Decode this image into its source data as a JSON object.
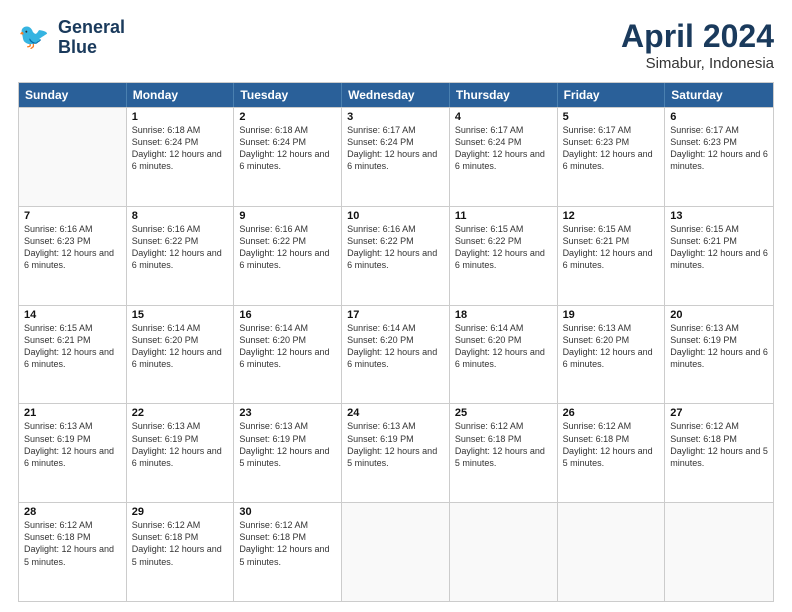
{
  "logo": {
    "line1": "General",
    "line2": "Blue"
  },
  "title": "April 2024",
  "subtitle": "Simabur, Indonesia",
  "days": [
    "Sunday",
    "Monday",
    "Tuesday",
    "Wednesday",
    "Thursday",
    "Friday",
    "Saturday"
  ],
  "weeks": [
    [
      {
        "day": "",
        "empty": true
      },
      {
        "day": "1",
        "sunrise": "6:18 AM",
        "sunset": "6:24 PM",
        "daylight": "12 hours and 6 minutes."
      },
      {
        "day": "2",
        "sunrise": "6:18 AM",
        "sunset": "6:24 PM",
        "daylight": "12 hours and 6 minutes."
      },
      {
        "day": "3",
        "sunrise": "6:17 AM",
        "sunset": "6:24 PM",
        "daylight": "12 hours and 6 minutes."
      },
      {
        "day": "4",
        "sunrise": "6:17 AM",
        "sunset": "6:24 PM",
        "daylight": "12 hours and 6 minutes."
      },
      {
        "day": "5",
        "sunrise": "6:17 AM",
        "sunset": "6:23 PM",
        "daylight": "12 hours and 6 minutes."
      },
      {
        "day": "6",
        "sunrise": "6:17 AM",
        "sunset": "6:23 PM",
        "daylight": "12 hours and 6 minutes."
      }
    ],
    [
      {
        "day": "7",
        "sunrise": "6:16 AM",
        "sunset": "6:23 PM",
        "daylight": "12 hours and 6 minutes."
      },
      {
        "day": "8",
        "sunrise": "6:16 AM",
        "sunset": "6:22 PM",
        "daylight": "12 hours and 6 minutes."
      },
      {
        "day": "9",
        "sunrise": "6:16 AM",
        "sunset": "6:22 PM",
        "daylight": "12 hours and 6 minutes."
      },
      {
        "day": "10",
        "sunrise": "6:16 AM",
        "sunset": "6:22 PM",
        "daylight": "12 hours and 6 minutes."
      },
      {
        "day": "11",
        "sunrise": "6:15 AM",
        "sunset": "6:22 PM",
        "daylight": "12 hours and 6 minutes."
      },
      {
        "day": "12",
        "sunrise": "6:15 AM",
        "sunset": "6:21 PM",
        "daylight": "12 hours and 6 minutes."
      },
      {
        "day": "13",
        "sunrise": "6:15 AM",
        "sunset": "6:21 PM",
        "daylight": "12 hours and 6 minutes."
      }
    ],
    [
      {
        "day": "14",
        "sunrise": "6:15 AM",
        "sunset": "6:21 PM",
        "daylight": "12 hours and 6 minutes."
      },
      {
        "day": "15",
        "sunrise": "6:14 AM",
        "sunset": "6:20 PM",
        "daylight": "12 hours and 6 minutes."
      },
      {
        "day": "16",
        "sunrise": "6:14 AM",
        "sunset": "6:20 PM",
        "daylight": "12 hours and 6 minutes."
      },
      {
        "day": "17",
        "sunrise": "6:14 AM",
        "sunset": "6:20 PM",
        "daylight": "12 hours and 6 minutes."
      },
      {
        "day": "18",
        "sunrise": "6:14 AM",
        "sunset": "6:20 PM",
        "daylight": "12 hours and 6 minutes."
      },
      {
        "day": "19",
        "sunrise": "6:13 AM",
        "sunset": "6:20 PM",
        "daylight": "12 hours and 6 minutes."
      },
      {
        "day": "20",
        "sunrise": "6:13 AM",
        "sunset": "6:19 PM",
        "daylight": "12 hours and 6 minutes."
      }
    ],
    [
      {
        "day": "21",
        "sunrise": "6:13 AM",
        "sunset": "6:19 PM",
        "daylight": "12 hours and 6 minutes."
      },
      {
        "day": "22",
        "sunrise": "6:13 AM",
        "sunset": "6:19 PM",
        "daylight": "12 hours and 6 minutes."
      },
      {
        "day": "23",
        "sunrise": "6:13 AM",
        "sunset": "6:19 PM",
        "daylight": "12 hours and 5 minutes."
      },
      {
        "day": "24",
        "sunrise": "6:13 AM",
        "sunset": "6:19 PM",
        "daylight": "12 hours and 5 minutes."
      },
      {
        "day": "25",
        "sunrise": "6:12 AM",
        "sunset": "6:18 PM",
        "daylight": "12 hours and 5 minutes."
      },
      {
        "day": "26",
        "sunrise": "6:12 AM",
        "sunset": "6:18 PM",
        "daylight": "12 hours and 5 minutes."
      },
      {
        "day": "27",
        "sunrise": "6:12 AM",
        "sunset": "6:18 PM",
        "daylight": "12 hours and 5 minutes."
      }
    ],
    [
      {
        "day": "28",
        "sunrise": "6:12 AM",
        "sunset": "6:18 PM",
        "daylight": "12 hours and 5 minutes."
      },
      {
        "day": "29",
        "sunrise": "6:12 AM",
        "sunset": "6:18 PM",
        "daylight": "12 hours and 5 minutes."
      },
      {
        "day": "30",
        "sunrise": "6:12 AM",
        "sunset": "6:18 PM",
        "daylight": "12 hours and 5 minutes."
      },
      {
        "day": "",
        "empty": true
      },
      {
        "day": "",
        "empty": true
      },
      {
        "day": "",
        "empty": true
      },
      {
        "day": "",
        "empty": true
      }
    ]
  ]
}
